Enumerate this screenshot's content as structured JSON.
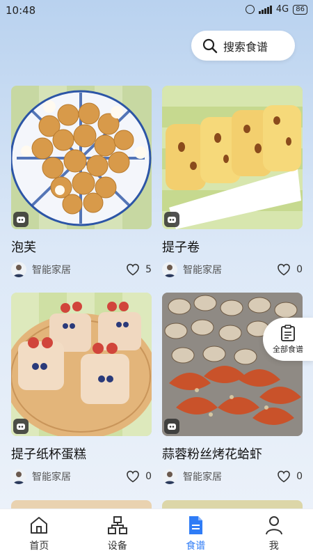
{
  "status_bar": {
    "time": "10:48",
    "network": "4G",
    "battery": "86"
  },
  "search": {
    "label": "搜索食谱",
    "icon": "search-icon"
  },
  "recipes": [
    {
      "title": "泡芙",
      "author": "智能家居",
      "likes": "5"
    },
    {
      "title": "提子卷",
      "author": "智能家居",
      "likes": "0"
    },
    {
      "title": "提子纸杯蛋糕",
      "author": "智能家居",
      "likes": "0"
    },
    {
      "title": "蒜蓉粉丝烤花蛤虾",
      "author": "智能家居",
      "likes": "0"
    }
  ],
  "floating": {
    "label": "全部食谱",
    "icon": "clipboard-icon"
  },
  "tabs": [
    {
      "label": "首页",
      "icon": "home-icon",
      "active": false
    },
    {
      "label": "设备",
      "icon": "device-tree-icon",
      "active": false
    },
    {
      "label": "食谱",
      "icon": "recipe-doc-icon",
      "active": true
    },
    {
      "label": "我",
      "icon": "person-icon",
      "active": false
    }
  ],
  "colors": {
    "accent": "#2f7cf6",
    "background_top": "#b9d2ef",
    "background_bottom": "#eef3fa"
  }
}
